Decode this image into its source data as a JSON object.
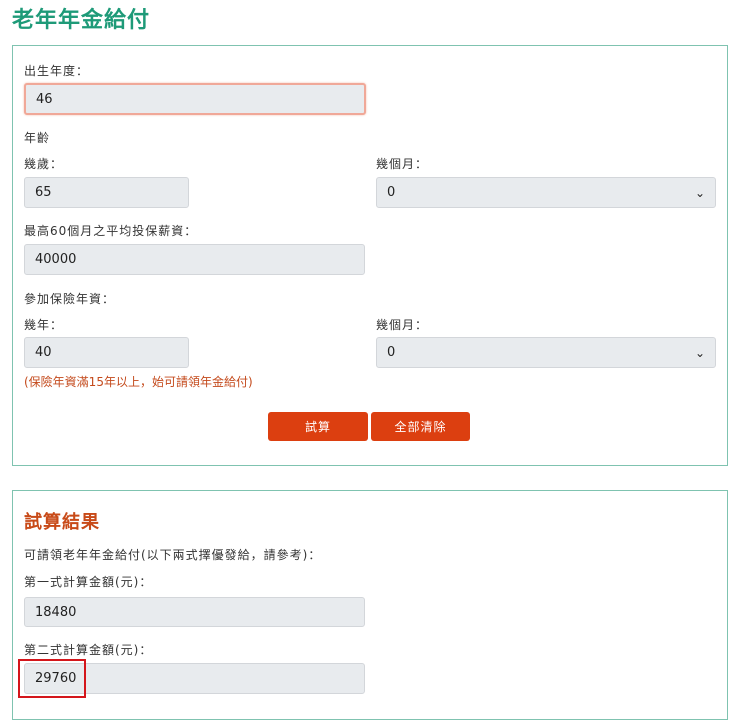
{
  "title": "老年年金給付",
  "form": {
    "birth_year_label": "出生年度：",
    "birth_year_value": "46",
    "age_heading": "年齡",
    "age_years_label": "幾歲：",
    "age_years_value": "65",
    "age_months_label": "幾個月：",
    "age_months_value": "0",
    "salary_label": "最高60個月之平均投保薪資：",
    "salary_value": "40000",
    "seniority_heading": "參加保險年資：",
    "seniority_years_label": "幾年：",
    "seniority_years_value": "40",
    "seniority_months_label": "幾個月：",
    "seniority_months_value": "0",
    "note": "(保險年資滿15年以上，始可請領年金給付)",
    "calc_button": "試算",
    "clear_button": "全部清除"
  },
  "result": {
    "title": "試算結果",
    "description": "可請領老年年金給付(以下兩式擇優發給，請參考)：",
    "formula1_label": "第一式計算金額(元)：",
    "formula1_value": "18480",
    "formula2_label": "第二式計算金額(元)：",
    "formula2_value": "29760"
  }
}
